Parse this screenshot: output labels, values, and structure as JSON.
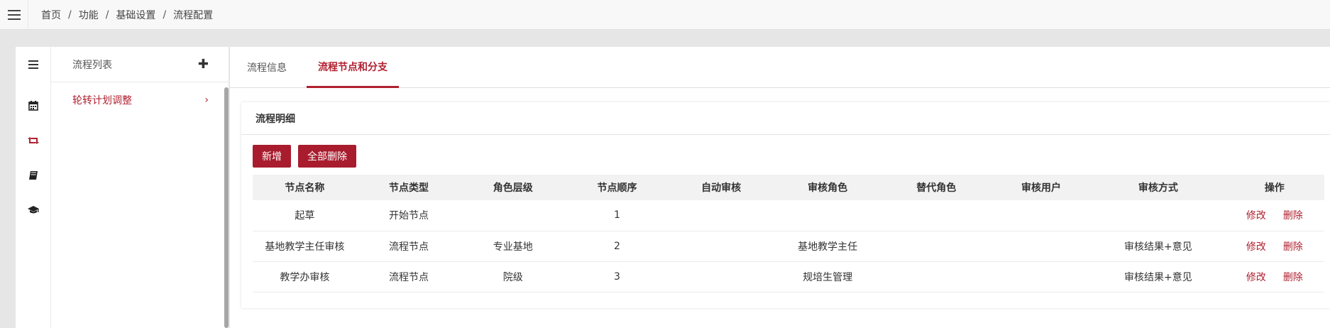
{
  "breadcrumb": [
    "首页",
    "功能",
    "基础设置",
    "流程配置"
  ],
  "sidebar": {
    "list_title": "流程列表",
    "items": [
      {
        "label": "轮转计划调整"
      }
    ],
    "icons": [
      "list-icon",
      "calendar-icon",
      "retweet-icon",
      "book-icon",
      "graduation-cap-icon"
    ]
  },
  "tabs": [
    {
      "label": "流程信息"
    },
    {
      "label": "流程节点和分支",
      "active": true
    }
  ],
  "card": {
    "title": "流程明细",
    "add_label": "新增",
    "delete_all_label": "全部删除"
  },
  "table": {
    "columns": [
      "节点名称",
      "节点类型",
      "角色层级",
      "节点顺序",
      "自动审核",
      "审核角色",
      "替代角色",
      "审核用户",
      "审核方式",
      "操作"
    ],
    "rows": [
      {
        "name": "起草",
        "type": "开始节点",
        "level": "",
        "order": "1",
        "auto": "",
        "role": "",
        "alt_role": "",
        "user": "",
        "method": ""
      },
      {
        "name": "基地教学主任审核",
        "type": "流程节点",
        "level": "专业基地",
        "order": "2",
        "auto": "",
        "role": "基地教学主任",
        "alt_role": "",
        "user": "",
        "method": "审核结果+意见"
      },
      {
        "name": "教学办审核",
        "type": "流程节点",
        "level": "院级",
        "order": "3",
        "auto": "",
        "role": "规培生管理",
        "alt_role": "",
        "user": "",
        "method": "审核结果+意见"
      }
    ],
    "edit_label": "修改",
    "delete_label": "删除"
  },
  "colors": {
    "accent": "#b0202f",
    "button": "#a81c2e"
  }
}
